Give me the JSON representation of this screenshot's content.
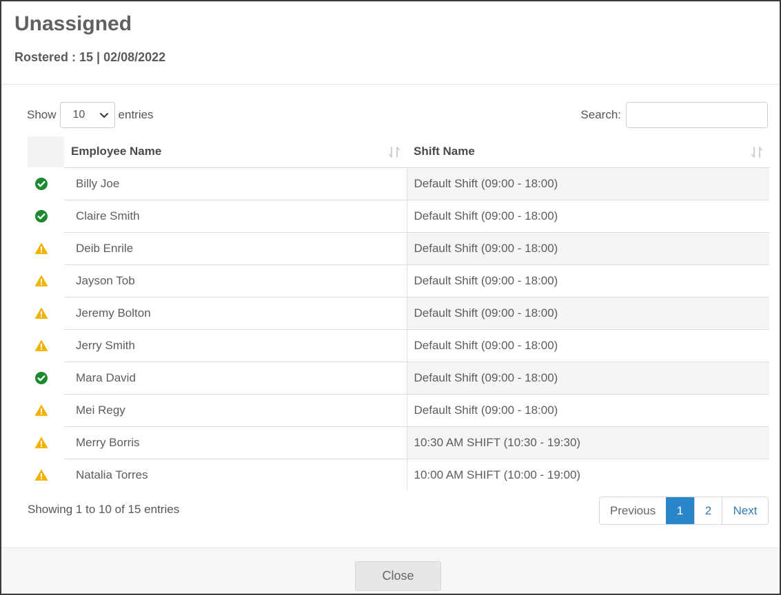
{
  "modal": {
    "title": "Unassigned",
    "subtitle": "Rostered : 15 | 02/08/2022"
  },
  "length_control": {
    "prefix": "Show",
    "selected": "10",
    "suffix": "entries"
  },
  "search": {
    "label": "Search:",
    "value": "",
    "placeholder": ""
  },
  "table": {
    "columns": [
      "",
      "Employee Name",
      "Shift Name"
    ],
    "rows": [
      {
        "status": "check",
        "name": "Billy Joe",
        "shift": "Default Shift (09:00 - 18:00)"
      },
      {
        "status": "check",
        "name": "Claire Smith",
        "shift": "Default Shift (09:00 - 18:00)"
      },
      {
        "status": "warning",
        "name": "Deib Enrile",
        "shift": "Default Shift (09:00 - 18:00)"
      },
      {
        "status": "warning",
        "name": "Jayson Tob",
        "shift": "Default Shift (09:00 - 18:00)"
      },
      {
        "status": "warning",
        "name": "Jeremy Bolton",
        "shift": "Default Shift (09:00 - 18:00)"
      },
      {
        "status": "warning",
        "name": "Jerry Smith",
        "shift": "Default Shift (09:00 - 18:00)"
      },
      {
        "status": "check",
        "name": "Mara David",
        "shift": "Default Shift (09:00 - 18:00)"
      },
      {
        "status": "warning",
        "name": "Mei Regy",
        "shift": "Default Shift (09:00 - 18:00)"
      },
      {
        "status": "warning",
        "name": "Merry Borris",
        "shift": "10:30 AM SHIFT (10:30 - 19:30)"
      },
      {
        "status": "warning",
        "name": "Natalia Torres",
        "shift": "10:00 AM SHIFT (10:00 - 19:00)"
      }
    ]
  },
  "info": "Showing 1 to 10 of 15 entries",
  "pagination": {
    "previous": "Previous",
    "pages": [
      "1",
      "2"
    ],
    "current": "1",
    "next": "Next"
  },
  "footer": {
    "close_label": "Close"
  },
  "colors": {
    "check": "#1b8a2f",
    "warning": "#f2b200",
    "accent": "#2a85c9"
  },
  "icons": {
    "check": "check-circle-icon",
    "warning": "warning-triangle-icon",
    "sort": "sort-icon",
    "dropdown": "chevron-down-icon"
  }
}
